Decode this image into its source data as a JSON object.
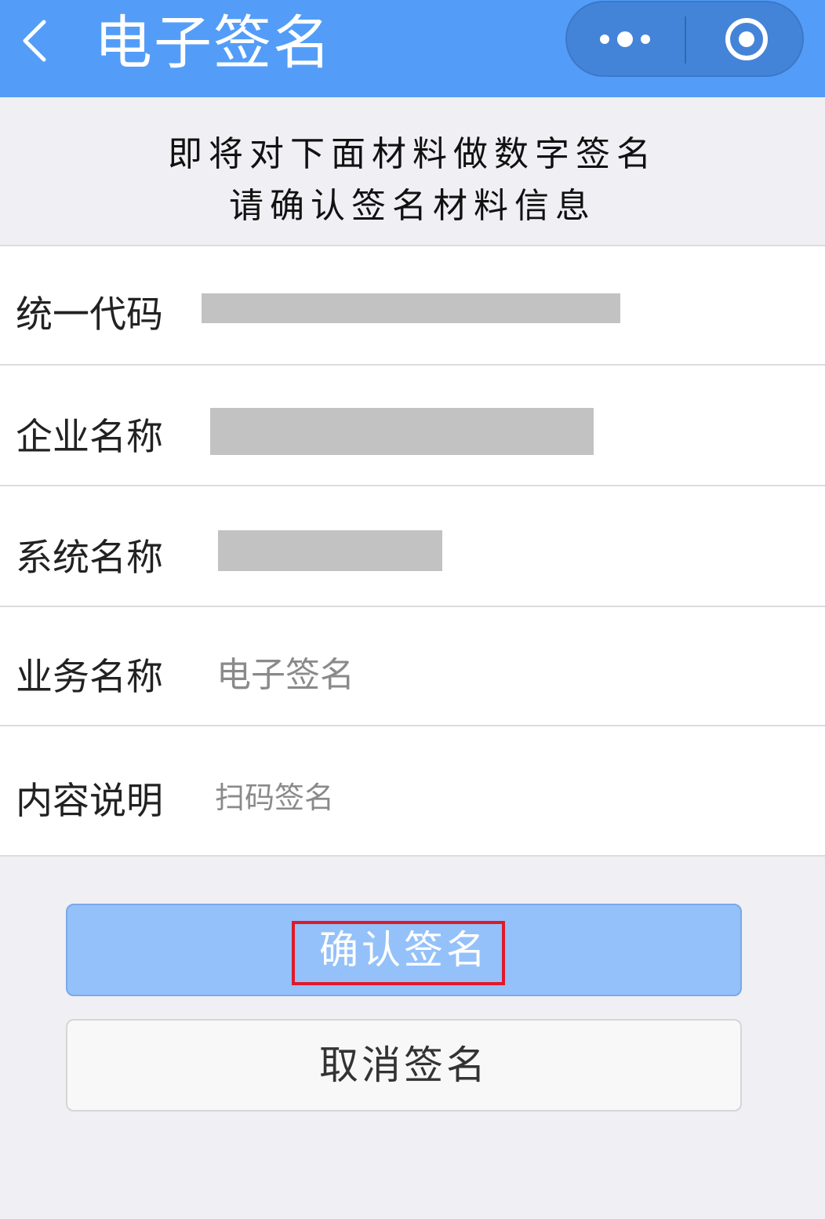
{
  "header": {
    "title": "电子签名",
    "back_icon": "chevron-left-icon",
    "more_icon": "more-dots-icon",
    "close_icon": "target-circle-icon",
    "background_color": "#539df8"
  },
  "notice": {
    "line1": "即将对下面材料做数字签名",
    "line2": "请确认签名材料信息"
  },
  "form": {
    "rows": [
      {
        "label": "统一代码",
        "value": "",
        "redacted": true
      },
      {
        "label": "企业名称",
        "value": "",
        "redacted": true
      },
      {
        "label": "系统名称",
        "value": "",
        "redacted": true
      },
      {
        "label": "业务名称",
        "value": "电子签名",
        "redacted": false
      },
      {
        "label": "内容说明",
        "value": "扫码签名",
        "redacted": false
      }
    ]
  },
  "buttons": {
    "confirm_label": "确认签名",
    "cancel_label": "取消签名",
    "confirm_color": "#94c1f9",
    "highlight_color": "#e0192a"
  }
}
